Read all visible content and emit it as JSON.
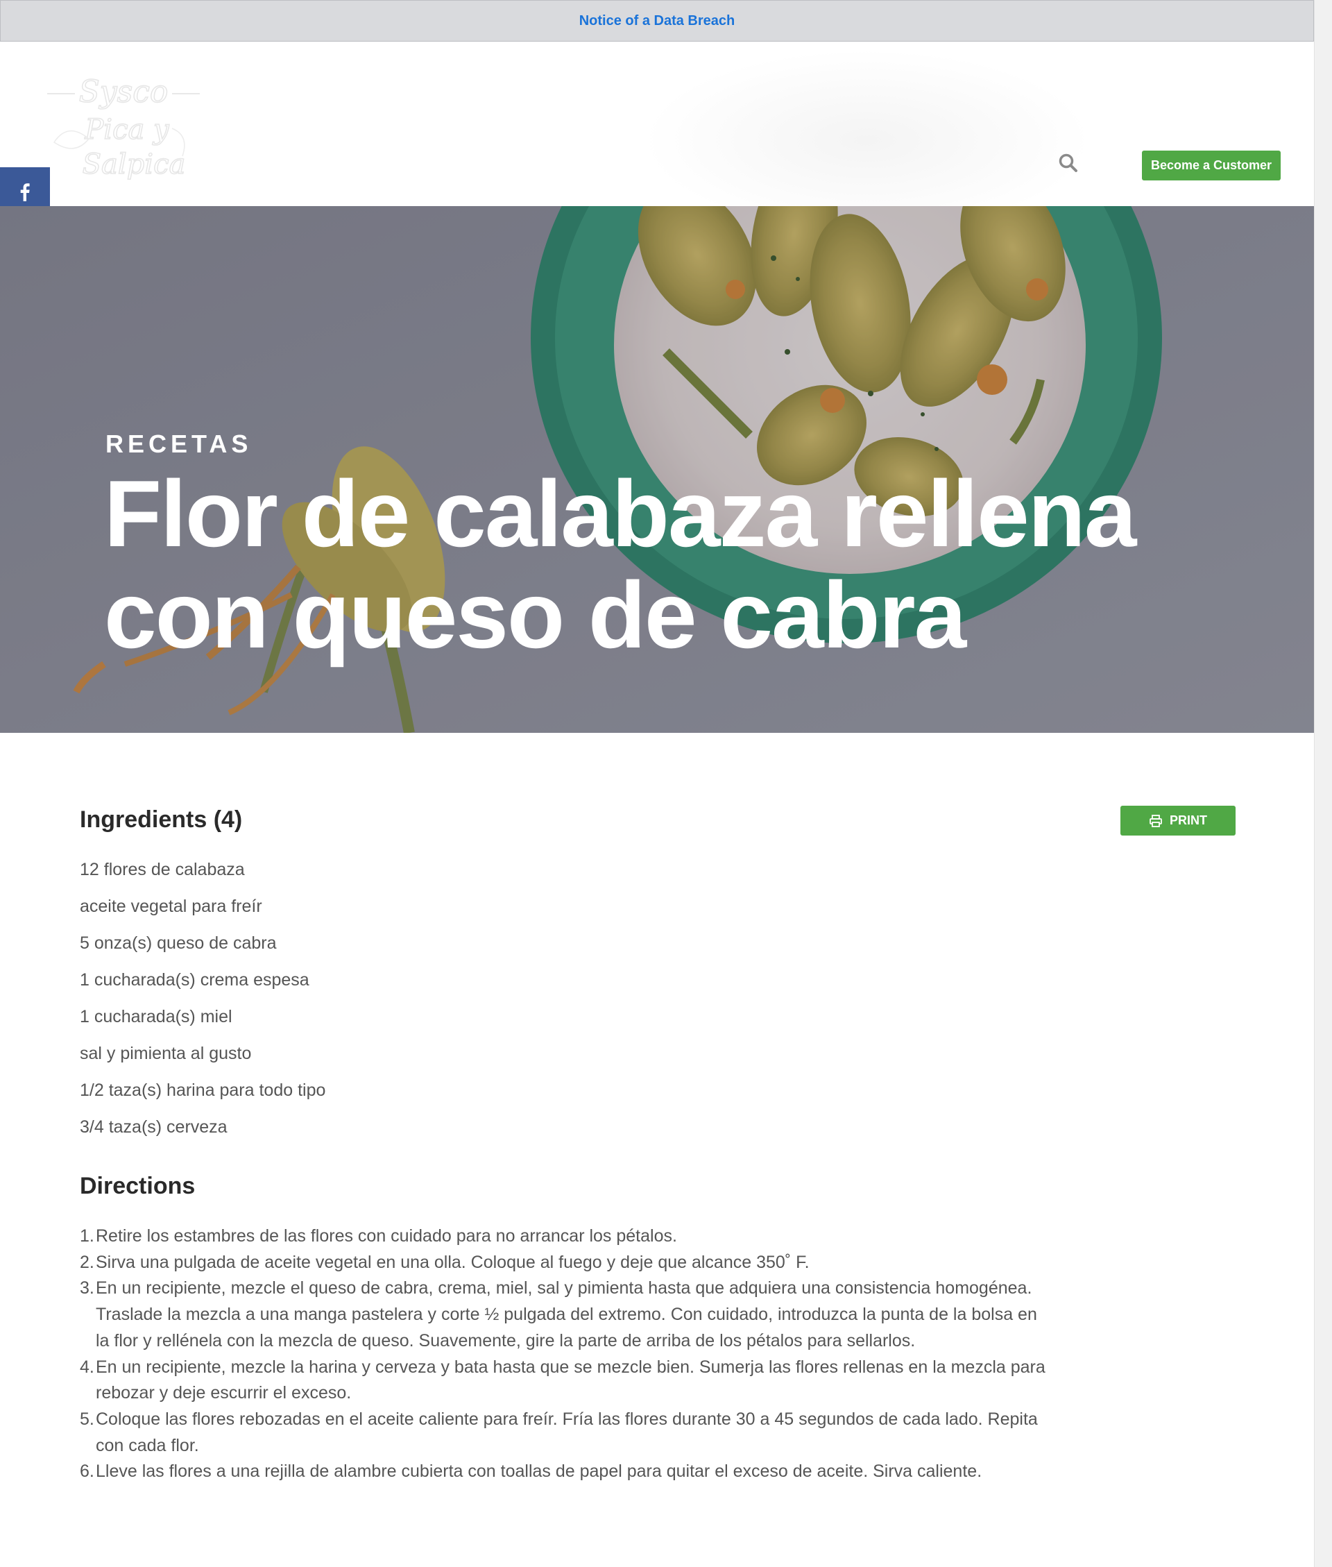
{
  "notice": {
    "link_text": "Notice of a Data Breach"
  },
  "header": {
    "logo_line1": "Sysco",
    "logo_line2": "Pica y",
    "logo_line3": "Salpica",
    "cta_label": "Become a Customer"
  },
  "share": {
    "items": [
      "facebook-icon",
      "x-icon",
      "pinterest-icon",
      "email-icon",
      "share-icon"
    ]
  },
  "hero": {
    "kicker": "RECETAS",
    "title_line1": "Flor de calabaza rellena",
    "title_line2": "con queso de cabra"
  },
  "ingredients": {
    "heading": "Ingredients (4)",
    "print_label": "PRINT",
    "items": [
      "12 flores de calabaza",
      "aceite vegetal para freír",
      "5 onza(s) queso de cabra",
      "1 cucharada(s) crema espesa",
      "1 cucharada(s) miel",
      "sal y pimienta al gusto",
      "1/2 taza(s) harina para todo tipo",
      "3/4 taza(s) cerveza"
    ]
  },
  "directions": {
    "heading": "Directions",
    "steps": [
      {
        "num": "1.",
        "text": "Retire los estambres de las flores con cuidado para no arrancar los pétalos."
      },
      {
        "num": "2.",
        "text": "Sirva una pulgada de aceite vegetal en una olla. Coloque al fuego y deje que alcance 350˚ F."
      },
      {
        "num": "3.",
        "text": "En un recipiente, mezcle el queso de cabra, crema, miel, sal y pimienta hasta que adquiera una consistencia homogénea. Traslade la mezcla a una manga pastelera y corte ½ pulgada del extremo. Con cuidado, introduzca la punta de la bolsa en la flor y rellénela con la mezcla de queso. Suavemente, gire la parte de arriba de los pétalos para sellarlos."
      },
      {
        "num": "4.",
        "text": "En un recipiente, mezcle la harina y cerveza y bata hasta que se mezcle bien. Sumerja las flores rellenas en la mezcla para rebozar y deje escurrir el exceso."
      },
      {
        "num": "5.",
        "text": "Coloque las flores rebozadas en el aceite caliente para freír. Fría las flores durante 30 a 45 segundos de cada lado. Repita con cada flor."
      },
      {
        "num": "6.",
        "text": "Lleve las flores a una rejilla de alambre cubierta con toallas de papel para quitar el exceso de aceite. Sirva caliente."
      }
    ]
  },
  "colors": {
    "brand_green": "#50a845",
    "notice_link": "#1a73d9",
    "facebook": "#3b5998",
    "pinterest": "#cb2027",
    "share": "#7ec242"
  }
}
